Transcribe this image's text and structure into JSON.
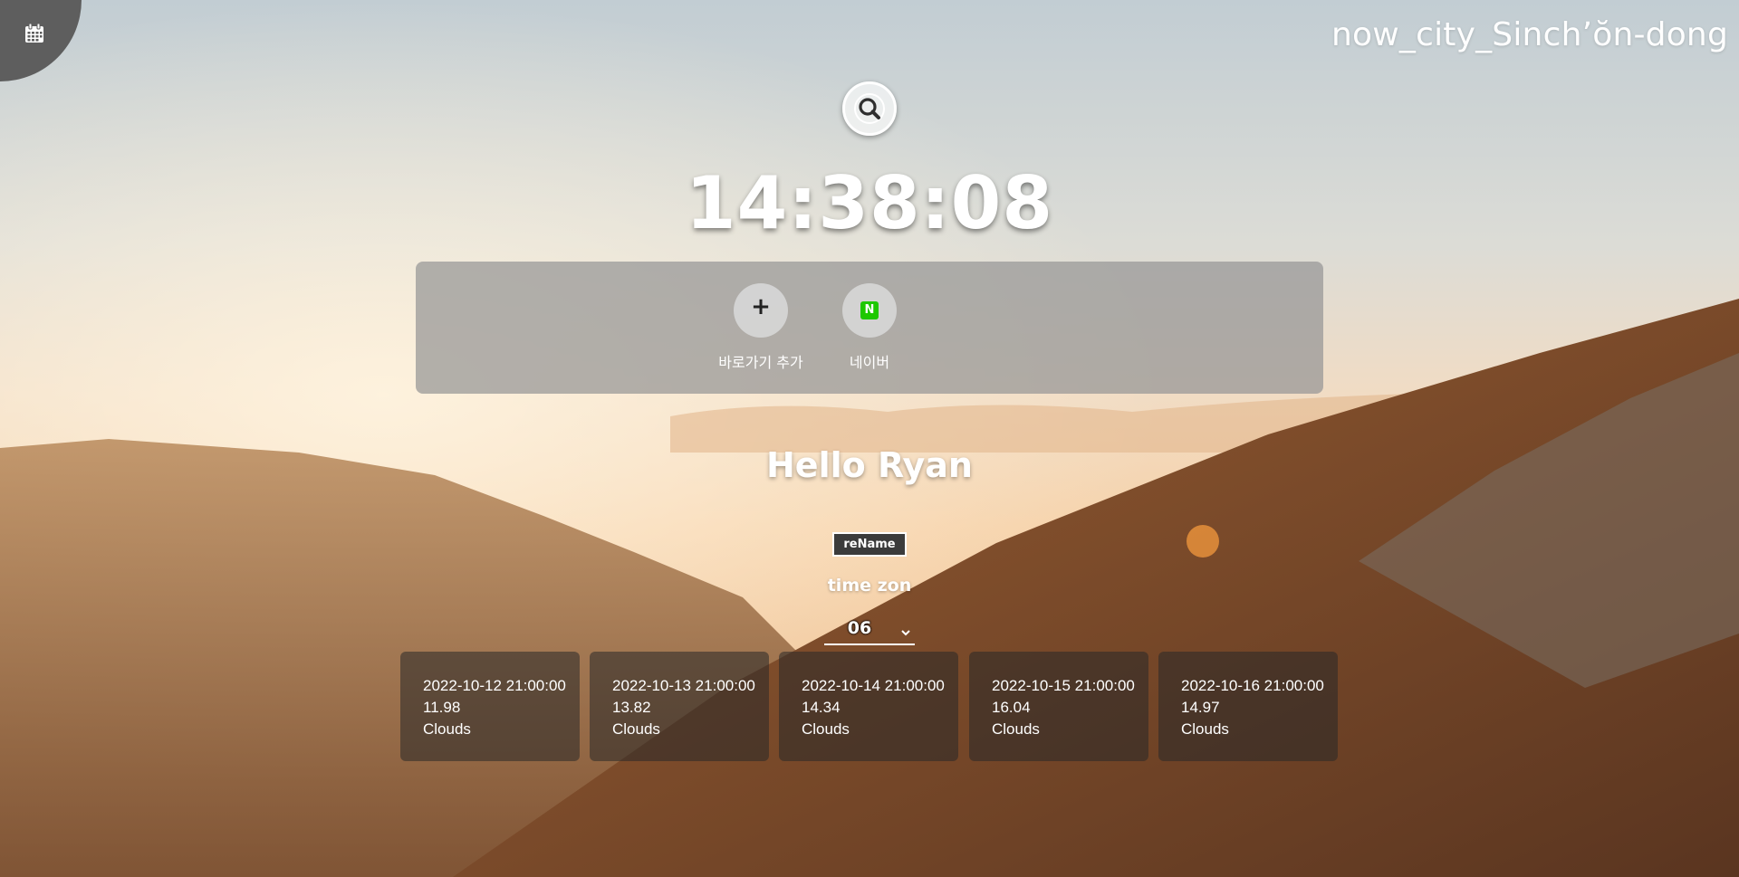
{
  "city": "now_city_Sinchʼŏn-dong",
  "clock": "14:38:08",
  "shortcuts": [
    {
      "label": "바로가기 추가",
      "icon": "plus-icon"
    },
    {
      "label": "네이버",
      "icon": "naver-icon",
      "icon_text": "N"
    }
  ],
  "greeting": "Hello Ryan",
  "rename_button": "reName",
  "timezone": {
    "label": "time zon",
    "value": "06"
  },
  "forecast": [
    {
      "datetime": "2022-10-12 21:00:00",
      "temp": "11.98",
      "weather": "Clouds"
    },
    {
      "datetime": "2022-10-13 21:00:00",
      "temp": "13.82",
      "weather": "Clouds"
    },
    {
      "datetime": "2022-10-14 21:00:00",
      "temp": "14.34",
      "weather": "Clouds"
    },
    {
      "datetime": "2022-10-15 21:00:00",
      "temp": "16.04",
      "weather": "Clouds"
    },
    {
      "datetime": "2022-10-16 21:00:00",
      "temp": "14.97",
      "weather": "Clouds"
    }
  ],
  "colors": {
    "naver_green": "#1ec800",
    "corner": "#5e5e5e"
  }
}
